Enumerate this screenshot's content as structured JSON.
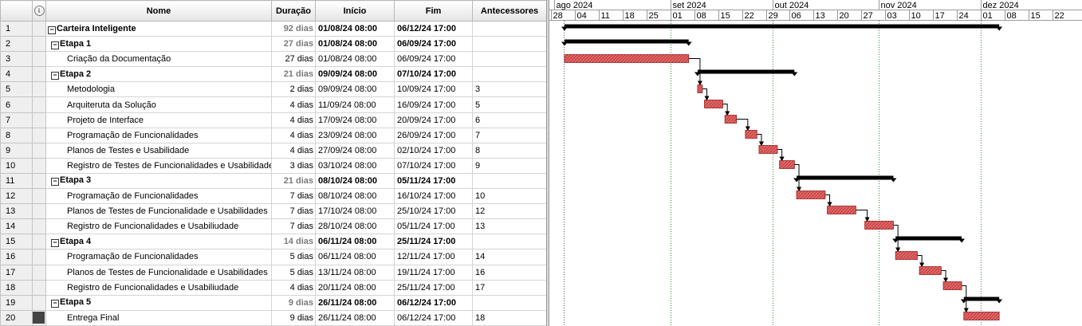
{
  "columns": {
    "nome": "Nome",
    "duracao": "Duração",
    "inicio": "Início",
    "fim": "Fim",
    "antecessores": "Antecessores"
  },
  "tasks": [
    {
      "id": "1",
      "name": "Carteira Inteligente",
      "dur": "92 dias",
      "start": "01/08/24 08:00",
      "end": "06/12/24 17:00",
      "pred": "",
      "level": 0,
      "summary": true,
      "s": 0,
      "e": 127.375
    },
    {
      "id": "2",
      "name": "Etapa 1",
      "dur": "27 dias",
      "start": "01/08/24 08:00",
      "end": "06/09/24 17:00",
      "pred": "",
      "level": 1,
      "summary": true,
      "s": 0,
      "e": 36.375
    },
    {
      "id": "3",
      "name": "Criação da Documentação",
      "dur": "27 dias",
      "start": "01/08/24 08:00",
      "end": "06/09/24 17:00",
      "pred": "",
      "level": 2,
      "summary": false,
      "s": 0,
      "e": 36.375
    },
    {
      "id": "4",
      "name": "Etapa 2",
      "dur": "21 dias",
      "start": "09/09/24 08:00",
      "end": "07/10/24 17:00",
      "pred": "",
      "level": 1,
      "summary": true,
      "s": 39,
      "e": 67.375
    },
    {
      "id": "5",
      "name": "Metodologia",
      "dur": "2 dias",
      "start": "09/09/24 08:00",
      "end": "10/09/24 17:00",
      "pred": "3",
      "level": 2,
      "summary": false,
      "s": 39,
      "e": 40.375
    },
    {
      "id": "6",
      "name": "Arquiteruta da Solução",
      "dur": "4 dias",
      "start": "11/09/24 08:00",
      "end": "16/09/24 17:00",
      "pred": "5",
      "level": 2,
      "summary": false,
      "s": 41,
      "e": 46.375
    },
    {
      "id": "7",
      "name": "Projeto de Interface",
      "dur": "4 dias",
      "start": "17/09/24 08:00",
      "end": "20/09/24 17:00",
      "pred": "6",
      "level": 2,
      "summary": false,
      "s": 47,
      "e": 50.375
    },
    {
      "id": "8",
      "name": "Programação de Funcionalidades",
      "dur": "4 dias",
      "start": "23/09/24 08:00",
      "end": "26/09/24 17:00",
      "pred": "7",
      "level": 2,
      "summary": false,
      "s": 53,
      "e": 56.375
    },
    {
      "id": "9",
      "name": "Planos de Testes e Usabilidade",
      "dur": "4 dias",
      "start": "27/09/24 08:00",
      "end": "02/10/24 17:00",
      "pred": "8",
      "level": 2,
      "summary": false,
      "s": 57,
      "e": 62.375
    },
    {
      "id": "10",
      "name": "Registro de Testes de Funcionalidades e Usabilidade",
      "dur": "3 dias",
      "start": "03/10/24 08:00",
      "end": "07/10/24 17:00",
      "pred": "9",
      "level": 2,
      "summary": false,
      "s": 63,
      "e": 67.375
    },
    {
      "id": "11",
      "name": "Etapa 3",
      "dur": "21 dias",
      "start": "08/10/24 08:00",
      "end": "05/11/24 17:00",
      "pred": "",
      "level": 1,
      "summary": true,
      "s": 68,
      "e": 96.375
    },
    {
      "id": "12",
      "name": "Programação de Funcionalidades",
      "dur": "7 dias",
      "start": "08/10/24 08:00",
      "end": "16/10/24 17:00",
      "pred": "10",
      "level": 2,
      "summary": false,
      "s": 68,
      "e": 76.375
    },
    {
      "id": "13",
      "name": "Planos de Testes de Funcionalidade e Usabilidades",
      "dur": "7 dias",
      "start": "17/10/24 08:00",
      "end": "25/10/24 17:00",
      "pred": "12",
      "level": 2,
      "summary": false,
      "s": 77,
      "e": 85.375
    },
    {
      "id": "14",
      "name": "Registro de Funcionalidades e Usabiliudade",
      "dur": "7 dias",
      "start": "28/10/24 08:00",
      "end": "05/11/24 17:00",
      "pred": "13",
      "level": 2,
      "summary": false,
      "s": 88,
      "e": 96.375
    },
    {
      "id": "15",
      "name": "Etapa 4",
      "dur": "14 dias",
      "start": "06/11/24 08:00",
      "end": "25/11/24 17:00",
      "pred": "",
      "level": 1,
      "summary": true,
      "s": 97,
      "e": 116.375
    },
    {
      "id": "16",
      "name": "Programação de Funcionalidades",
      "dur": "5 dias",
      "start": "06/11/24 08:00",
      "end": "12/11/24 17:00",
      "pred": "14",
      "level": 2,
      "summary": false,
      "s": 97,
      "e": 103.375
    },
    {
      "id": "17",
      "name": "Planos de Testes de Funcionalidade e Usabilidades",
      "dur": "5 dias",
      "start": "13/11/24 08:00",
      "end": "19/11/24 17:00",
      "pred": "16",
      "level": 2,
      "summary": false,
      "s": 104,
      "e": 110.375
    },
    {
      "id": "18",
      "name": "Registro de Funcionalidades e Usabiliudade",
      "dur": "4 dias",
      "start": "20/11/24 08:00",
      "end": "25/11/24 17:00",
      "pred": "17",
      "level": 2,
      "summary": false,
      "s": 111,
      "e": 116.375
    },
    {
      "id": "19",
      "name": "Etapa 5",
      "dur": "9 dias",
      "start": "26/11/24 08:00",
      "end": "06/12/24 17:00",
      "pred": "",
      "level": 1,
      "summary": true,
      "s": 117,
      "e": 127.375
    },
    {
      "id": "20",
      "name": "Entrega Final",
      "dur": "9 dias",
      "start": "26/11/24 08:00",
      "end": "06/12/24 17:00",
      "pred": "18",
      "level": 2,
      "summary": false,
      "s": 117,
      "e": 127.375,
      "selected": true
    }
  ],
  "timeline": {
    "months": [
      {
        "label": "ago 2024",
        "day": -3
      },
      {
        "label": "set 2024",
        "day": 31
      },
      {
        "label": "out 2024",
        "day": 61
      },
      {
        "label": "nov 2024",
        "day": 92
      },
      {
        "label": "dez 2024",
        "day": 122
      }
    ],
    "weeks": [
      "28",
      "04",
      "11",
      "18",
      "25",
      "01",
      "08",
      "15",
      "22",
      "29",
      "06",
      "13",
      "20",
      "27",
      "03",
      "10",
      "17",
      "24",
      "01",
      "08",
      "15",
      "22"
    ],
    "first_week_day": -4
  },
  "colors": {
    "task_bar": "#d45454",
    "summary_bar": "#000000",
    "month_line": "#2e8b2e"
  }
}
